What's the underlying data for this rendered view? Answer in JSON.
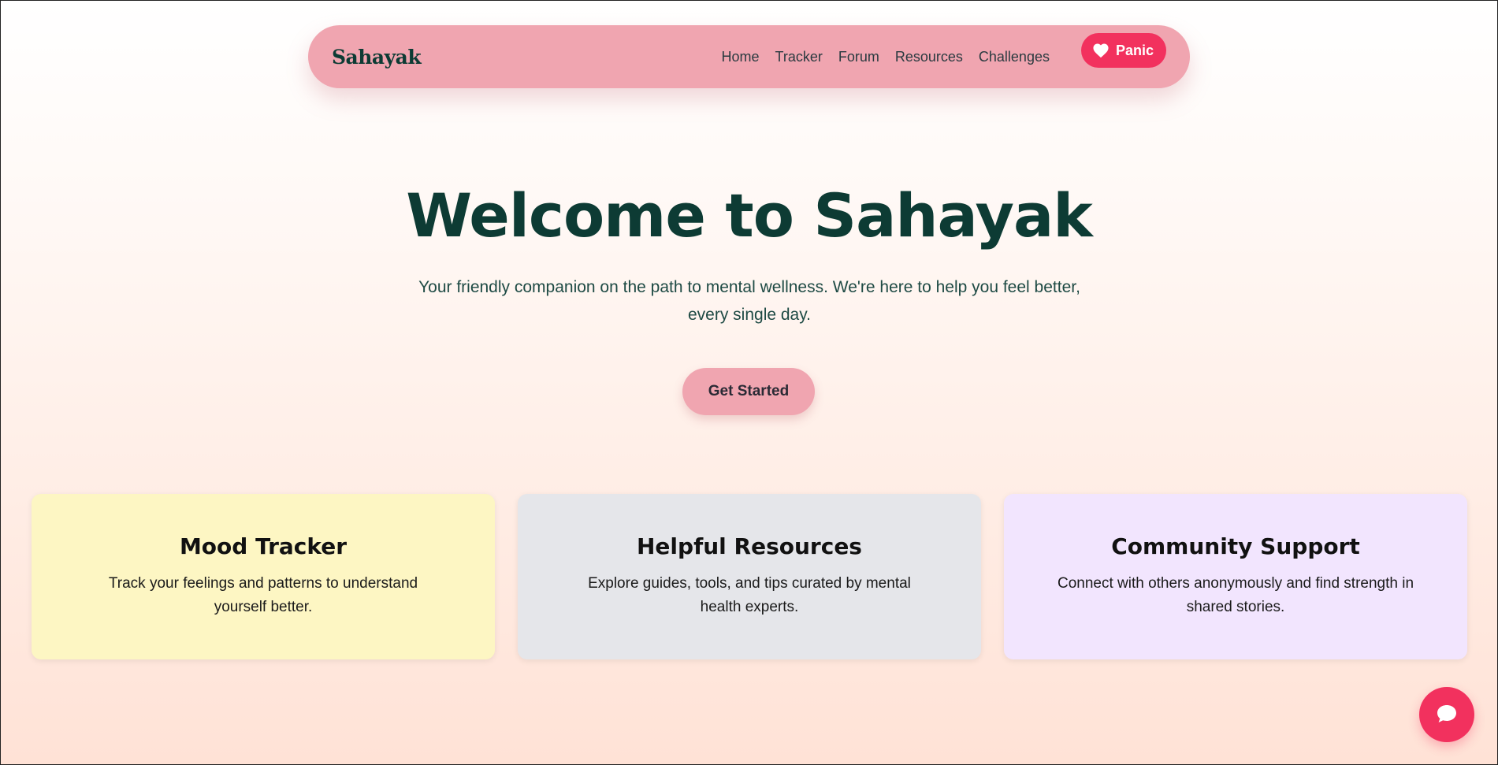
{
  "nav": {
    "logo": "Sahayak",
    "links": [
      "Home",
      "Tracker",
      "Forum",
      "Resources",
      "Challenges"
    ],
    "panic_label": "Panic",
    "panic_icon": "heart-icon"
  },
  "hero": {
    "title": "Welcome to Sahayak",
    "subtitle": "Your friendly companion on the path to mental wellness. We're here to help you feel better, every single day.",
    "cta_label": "Get Started"
  },
  "features": [
    {
      "title": "Mood Tracker",
      "description": "Track your feelings and patterns to understand yourself better."
    },
    {
      "title": "Helpful Resources",
      "description": "Explore guides, tools, and tips curated by mental health experts."
    },
    {
      "title": "Community Support",
      "description": "Connect with others anonymously and find strength in shared stories."
    }
  ],
  "chat": {
    "icon": "chat-bubble-icon"
  },
  "colors": {
    "accent_pink": "#f0a5b0",
    "panic_red": "#f2315e",
    "dark_green": "#0d3b34",
    "card_yellow": "#fdf6c3",
    "card_gray": "#e5e6ea",
    "card_lavender": "#f2e5fe"
  }
}
